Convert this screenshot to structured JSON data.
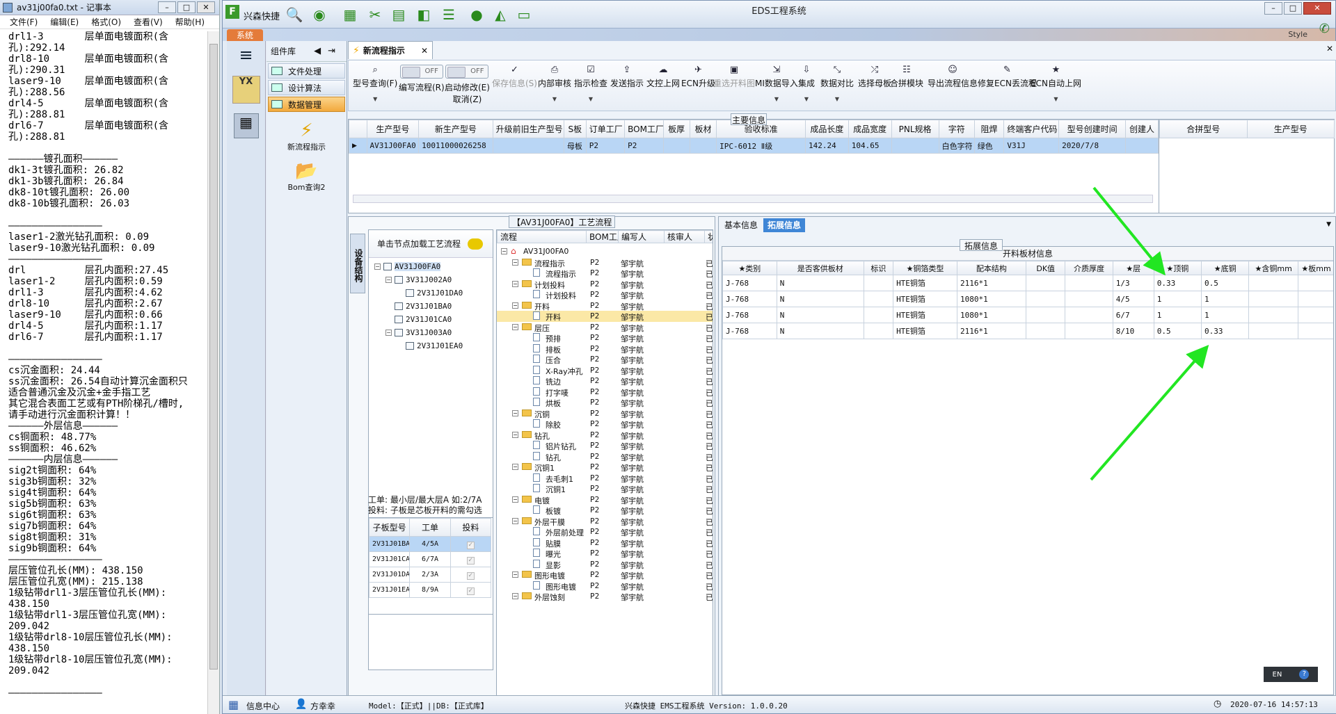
{
  "notepad": {
    "title": "av31j00fa0.txt - 记事本",
    "menu": [
      "文件(F)",
      "编辑(E)",
      "格式(O)",
      "查看(V)",
      "帮助(H)"
    ],
    "lines": [
      "drl1-3       层单面电镀面积(含",
      "孔):292.14",
      "drl8-10      层单面电镀面积(含",
      "孔):290.31",
      "laser9-10    层单面电镀面积(含",
      "孔):288.56",
      "drl4-5       层单面电镀面积(含",
      "孔):288.81",
      "drl6-7       层单面电镀面积(含",
      "孔):288.81",
      "",
      "——————镀孔面积——————",
      "dk1-3t镀孔面积: 26.82",
      "dk1-3b镀孔面积: 26.84",
      "dk8-10t镀孔面积: 26.00",
      "dk8-10b镀孔面积: 26.03",
      "",
      "————————————————",
      "laser1-2激光钻孔面积: 0.09",
      "laser9-10激光钻孔面积: 0.09",
      "————————————————",
      "drl          层孔内面积:27.45",
      "laser1-2     层孔内面积:0.59",
      "drl1-3       层孔内面积:4.62",
      "drl8-10      层孔内面积:2.67",
      "laser9-10    层孔内面积:0.66",
      "drl4-5       层孔内面积:1.17",
      "drl6-7       层孔内面积:1.17",
      "",
      "————————————————",
      "cs沉金面积: 24.44",
      "ss沉金面积: 26.54自动计算沉金面积只",
      "适合普通沉金及沉金+金手指工艺",
      "其它混合表面工艺或有PTH阶梯孔/槽时,",
      "请手动进行沉金面积计算！！",
      "——————外层信息——————",
      "cs铜面积: 48.77%",
      "ss铜面积: 46.62%",
      "——————内层信息——————",
      "sig2t铜面积: 64%",
      "sig3b铜面积: 32%",
      "sig4t铜面积: 64%",
      "sig5b铜面积: 63%",
      "sig6t铜面积: 63%",
      "sig7b铜面积: 64%",
      "sig8t铜面积: 31%",
      "sig9b铜面积: 64%",
      "————————————————",
      "层压管位孔长(MM): 438.150",
      "层压管位孔宽(MM): 215.138",
      "1级钻带drl1-3层压管位孔长(MM):",
      "438.150",
      "1级钻带drl1-3层压管位孔宽(MM):",
      "209.042",
      "1级钻带drl8-10层压管位孔长(MM):",
      "438.150",
      "1级钻带drl8-10层压管位孔宽(MM):",
      "209.042",
      "",
      "————————————————"
    ]
  },
  "app": {
    "title": "EDS工程系统",
    "brand": "兴森快捷",
    "sys_tab": "系统",
    "style_label": "Style"
  },
  "sidebar": {
    "header": "组件库",
    "items": [
      "文件处理",
      "设计算法",
      "数据管理"
    ],
    "active_index": 2,
    "big_items": [
      "新流程指示",
      "Bom查询2"
    ],
    "rail_logo": "YX"
  },
  "tab": {
    "label": "新流程指示"
  },
  "ribbon": {
    "items": [
      {
        "label": "型号查询(F)",
        "icon": "search-icon",
        "dropdown": true
      },
      {
        "label": "编写流程(R)",
        "toggle": "OFF"
      },
      {
        "label": "启动修改(E)",
        "toggle": "OFF",
        "sub": "取消(Z)"
      },
      {
        "label": "保存信息(S)",
        "disabled": true
      },
      {
        "label": "内部审核",
        "dropdown": true
      },
      {
        "label": "指示检查",
        "dropdown": true
      },
      {
        "label": "发送指示"
      },
      {
        "label": "文控上网"
      },
      {
        "label": "ECN升级"
      },
      {
        "label": "重选开料图",
        "disabled": true
      },
      {
        "label": "MI数据导入",
        "dropdown": true
      },
      {
        "label": "集成",
        "dropdown": true
      },
      {
        "label": "数据对比",
        "dropdown": true
      },
      {
        "label": "选择母板"
      },
      {
        "label": "合拼模块"
      },
      {
        "label": "导出流程信息"
      },
      {
        "label": "修复ECN丢流程"
      },
      {
        "label": "ECN自动上网",
        "dropdown": true
      }
    ]
  },
  "main_info": {
    "label": "主要信息",
    "columns": [
      "生产型号",
      "新生产型号",
      "升级前旧生产型号",
      "S板",
      "订单工厂",
      "BOM工厂",
      "板厚",
      "板材",
      "验收标准",
      "成品长度",
      "成品宽度",
      "PNL规格",
      "字符",
      "阻焊",
      "终端客户代码",
      "型号创建时间",
      "创建人"
    ],
    "rows": [
      [
        "AV31J00FA0",
        "10011000026258",
        "",
        "母板",
        "P2",
        "P2",
        "",
        "",
        "IPC-6012 Ⅱ级",
        "142.24",
        "104.65",
        "",
        "白色字符",
        "绿色",
        "V31J",
        "2020/7/8",
        ""
      ]
    ],
    "right_columns": [
      "合拼型号",
      "生产型号"
    ]
  },
  "process": {
    "title": "【AV31J00FA0】工艺流程",
    "vtab": "设备结构",
    "tree_hint": "单击节点加载工艺流程",
    "tree": [
      {
        "label": "AV31J00FA0",
        "level": 0,
        "selected": true
      },
      {
        "label": "3V31J002A0",
        "level": 1
      },
      {
        "label": "2V31J01DA0",
        "level": 2
      },
      {
        "label": "2V31J01BA0",
        "level": 1
      },
      {
        "label": "2V31J01CA0",
        "level": 1
      },
      {
        "label": "3V31J003A0",
        "level": 1
      },
      {
        "label": "2V31J01EA0",
        "level": 2
      }
    ],
    "info1": "工单: 最小层/最大层A 如:2/7A",
    "info2": "投料: 子板是芯板开料的需勾选",
    "sub_columns": [
      "子板型号",
      "工单",
      "投料"
    ],
    "sub_rows": [
      [
        "2V31J01BA0",
        "4/5A"
      ],
      [
        "2V31J01CA0",
        "6/7A"
      ],
      [
        "2V31J01DA0",
        "2/3A"
      ],
      [
        "2V31J01EA0",
        "8/9A"
      ]
    ],
    "flow_columns": [
      "流程",
      "BOM工厂",
      "编写人",
      "核审人",
      "状态"
    ],
    "flow_rows": [
      {
        "name": "AV31J00FA0",
        "type": "root",
        "level": 0
      },
      {
        "name": "流程指示",
        "type": "folder",
        "level": 1,
        "bom": "P2",
        "writer": "邹宇航",
        "status": "已编写"
      },
      {
        "name": "流程指示",
        "type": "doc",
        "level": 2,
        "bom": "P2",
        "writer": "邹宇航",
        "status": "已编写"
      },
      {
        "name": "计划投料",
        "type": "folder",
        "level": 1,
        "bom": "P2",
        "writer": "邹宇航",
        "status": "已编写"
      },
      {
        "name": "计划投料",
        "type": "doc",
        "level": 2,
        "bom": "P2",
        "writer": "邹宇航",
        "status": "已编写"
      },
      {
        "name": "开料",
        "type": "folder",
        "level": 1,
        "bom": "P2",
        "writer": "邹宇航",
        "status": "已编写"
      },
      {
        "name": "开料",
        "type": "doc",
        "level": 2,
        "bom": "P2",
        "writer": "邹宇航",
        "status": "已编写",
        "hl": true
      },
      {
        "name": "层压",
        "type": "folder",
        "level": 1,
        "bom": "P2",
        "writer": "邹宇航",
        "status": "已编写"
      },
      {
        "name": "预排",
        "type": "doc",
        "level": 2,
        "bom": "P2",
        "writer": "邹宇航",
        "status": "已编写"
      },
      {
        "name": "排板",
        "type": "doc",
        "level": 2,
        "bom": "P2",
        "writer": "邹宇航",
        "status": "已编写"
      },
      {
        "name": "压合",
        "type": "doc",
        "level": 2,
        "bom": "P2",
        "writer": "邹宇航",
        "status": "已编写"
      },
      {
        "name": "X-Ray冲孔",
        "type": "doc",
        "level": 2,
        "bom": "P2",
        "writer": "邹宇航",
        "status": "已编写"
      },
      {
        "name": "铣边",
        "type": "doc",
        "level": 2,
        "bom": "P2",
        "writer": "邹宇航",
        "status": "已编写"
      },
      {
        "name": "打字唛",
        "type": "doc",
        "level": 2,
        "bom": "P2",
        "writer": "邹宇航",
        "status": "已编写"
      },
      {
        "name": "烘板",
        "type": "doc",
        "level": 2,
        "bom": "P2",
        "writer": "邹宇航",
        "status": "已编写"
      },
      {
        "name": "沉铜",
        "type": "folder",
        "level": 1,
        "bom": "P2",
        "writer": "邹宇航",
        "status": "已编写"
      },
      {
        "name": "除胶",
        "type": "doc",
        "level": 2,
        "bom": "P2",
        "writer": "邹宇航",
        "status": "已编写"
      },
      {
        "name": "钻孔",
        "type": "folder",
        "level": 1,
        "bom": "P2",
        "writer": "邹宇航",
        "status": "已编写"
      },
      {
        "name": "铝片钻孔",
        "type": "doc",
        "level": 2,
        "bom": "P2",
        "writer": "邹宇航",
        "status": "已编写"
      },
      {
        "name": "钻孔",
        "type": "doc",
        "level": 2,
        "bom": "P2",
        "writer": "邹宇航",
        "status": "已编写"
      },
      {
        "name": "沉铜1",
        "type": "folder",
        "level": 1,
        "bom": "P2",
        "writer": "邹宇航",
        "status": "已编写"
      },
      {
        "name": "去毛刺1",
        "type": "doc",
        "level": 2,
        "bom": "P2",
        "writer": "邹宇航",
        "status": "已编写"
      },
      {
        "name": "沉铜1",
        "type": "doc",
        "level": 2,
        "bom": "P2",
        "writer": "邹宇航",
        "status": "已编写"
      },
      {
        "name": "电镀",
        "type": "folder",
        "level": 1,
        "bom": "P2",
        "writer": "邹宇航",
        "status": "已编写"
      },
      {
        "name": "板镀",
        "type": "doc",
        "level": 2,
        "bom": "P2",
        "writer": "邹宇航",
        "status": "已编写"
      },
      {
        "name": "外层干膜",
        "type": "folder",
        "level": 1,
        "bom": "P2",
        "writer": "邹宇航",
        "status": "已编写"
      },
      {
        "name": "外层前处理",
        "type": "doc",
        "level": 2,
        "bom": "P2",
        "writer": "邹宇航",
        "status": "已编写"
      },
      {
        "name": "贴膜",
        "type": "doc",
        "level": 2,
        "bom": "P2",
        "writer": "邹宇航",
        "status": "已编写"
      },
      {
        "name": "曝光",
        "type": "doc",
        "level": 2,
        "bom": "P2",
        "writer": "邹宇航",
        "status": "已编写"
      },
      {
        "name": "显影",
        "type": "doc",
        "level": 2,
        "bom": "P2",
        "writer": "邹宇航",
        "status": "已编写"
      },
      {
        "name": "图形电镀",
        "type": "folder",
        "level": 1,
        "bom": "P2",
        "writer": "邹宇航",
        "status": "已编写"
      },
      {
        "name": "图形电镀",
        "type": "doc",
        "level": 2,
        "bom": "P2",
        "writer": "邹宇航",
        "status": "已编写"
      },
      {
        "name": "外层蚀刻",
        "type": "folder",
        "level": 1,
        "bom": "P2",
        "writer": "邹宇航",
        "status": "已编写"
      }
    ]
  },
  "detail": {
    "tabs": [
      "基本信息",
      "拓展信息"
    ],
    "active_tab": 1,
    "section": "拓展信息",
    "table_title": "开料板材信息",
    "columns": [
      "★类别",
      "是否客供板材",
      "标识",
      "★铜箔类型",
      "配本结构",
      "DK值",
      "介质厚度",
      "★层",
      "★顶铜",
      "★底铜",
      "★含铜mm",
      "★板mm"
    ],
    "rows": [
      [
        "J-768",
        "N",
        "",
        "HTE铜箔",
        "2116*1",
        "",
        "",
        "1/3",
        "0.33",
        "0.5",
        "",
        ""
      ],
      [
        "J-768",
        "N",
        "",
        "HTE铜箔",
        "1080*1",
        "",
        "",
        "4/5",
        "1",
        "1",
        "",
        ""
      ],
      [
        "J-768",
        "N",
        "",
        "HTE铜箔",
        "1080*1",
        "",
        "",
        "6/7",
        "1",
        "1",
        "",
        ""
      ],
      [
        "J-768",
        "N",
        "",
        "HTE铜箔",
        "2116*1",
        "",
        "",
        "8/10",
        "0.5",
        "0.33",
        "",
        ""
      ]
    ],
    "lang": "EN"
  },
  "status": {
    "info_center": "信息中心",
    "user": "方幸幸",
    "model": "Model:【正式】||DB:【正式库】",
    "version": "兴森快捷  EMS工程系统  Version: 1.0.0.20",
    "datetime": "2020-07-16  14:57:13"
  },
  "colors": {
    "arrow": "#22e622",
    "selected_row": "#b9d6f5",
    "active_tab": "#3f86d6",
    "highlight": "#fbe8a6"
  }
}
